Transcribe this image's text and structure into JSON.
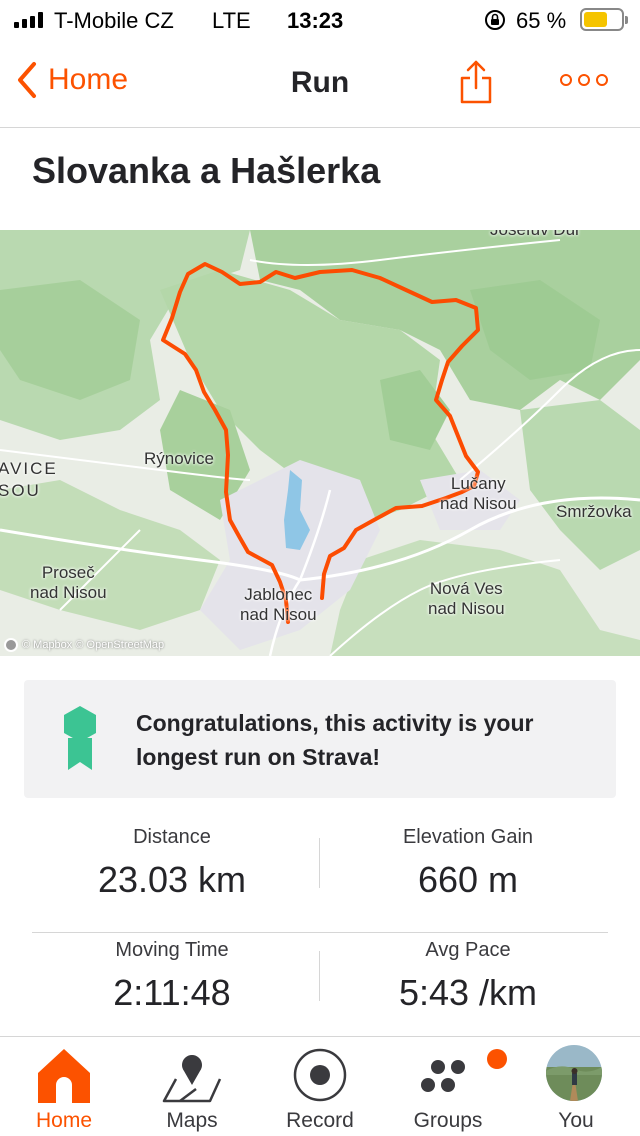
{
  "status": {
    "carrier": "T-Mobile CZ",
    "network": "LTE",
    "time": "13:23",
    "battery_percent": "65 %",
    "battery_level": 0.65
  },
  "nav": {
    "back_label": "Home",
    "title": "Run"
  },
  "activity": {
    "title": "Slovanka a Hašlerka"
  },
  "map": {
    "labels": {
      "josefuv_dul": "Josefův Důl",
      "rynovice": "Rýnovice",
      "avice": "AVICE",
      "sou": "SOU",
      "lucany": "Lučany\nnad Nisou",
      "smrzovka": "Smržovka",
      "prosec": "Proseč\nnad Nisou",
      "jablonec": "Jablonec\nnad Nisou",
      "nova_ves": "Nová Ves\nnad Nisou"
    },
    "attribution": "© Mapbox © OpenStreetMap",
    "route_color": "#fc4c02"
  },
  "achievement": {
    "text": "Congratulations, this activity is your longest run on Strava!"
  },
  "stats": {
    "distance_label": "Distance",
    "distance_value": "23.03 km",
    "elevation_label": "Elevation Gain",
    "elevation_value": "660 m",
    "moving_time_label": "Moving Time",
    "moving_time_value": "2:11:48",
    "pace_label": "Avg Pace",
    "pace_value": "5:43 /km"
  },
  "tabs": [
    {
      "label": "Home",
      "icon": "home-icon",
      "active": true
    },
    {
      "label": "Maps",
      "icon": "map-pin-icon",
      "active": false
    },
    {
      "label": "Record",
      "icon": "record-icon",
      "active": false
    },
    {
      "label": "Groups",
      "icon": "groups-icon",
      "active": false
    },
    {
      "label": "You",
      "icon": "avatar",
      "active": false
    }
  ],
  "colors": {
    "accent": "#fc5200",
    "medal": "#3cc493"
  }
}
